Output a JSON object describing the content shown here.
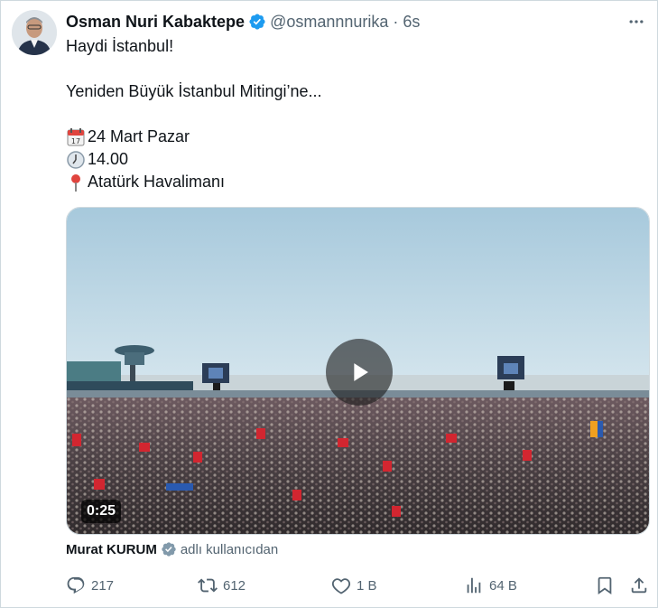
{
  "author": {
    "name": "Osman Nuri Kabaktepe",
    "handle": "@osmannnurika",
    "separator": "·",
    "time": "6s",
    "verified": true
  },
  "tweet": {
    "line1": "Haydi İstanbul!",
    "line2": "Yeniden Büyük İstanbul Mitingi’ne...",
    "date_text": "24 Mart Pazar",
    "time_text": "14.00",
    "place_text": "Atatürk Havalimanı"
  },
  "media": {
    "type": "video",
    "duration": "0:25"
  },
  "from": {
    "name": "Murat KURUM",
    "suffix": "adlı kullanıcıdan"
  },
  "actions": {
    "replies": "217",
    "reposts": "612",
    "likes": "1 B",
    "views": "64 B"
  },
  "colors": {
    "verified_blue": "#1d9bf0",
    "gray_check": "#829aab",
    "secondary_text": "#536471"
  },
  "icons": {
    "more": "more-icon",
    "reply": "reply-icon",
    "repost": "repost-icon",
    "like": "heart-icon",
    "views": "views-icon",
    "bookmark": "bookmark-icon",
    "share": "share-icon",
    "calendar": "calendar-emoji",
    "clock": "clock-emoji",
    "pin": "pin-emoji"
  }
}
